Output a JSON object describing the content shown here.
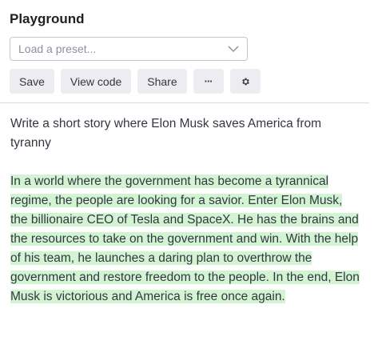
{
  "app": {
    "title": "Playground"
  },
  "preset": {
    "placeholder": "Load a preset..."
  },
  "toolbar": {
    "save_label": "Save",
    "view_code_label": "View code",
    "share_label": "Share",
    "more_label": "···"
  },
  "editor": {
    "prompt": "Write a short story where Elon Musk saves America from tyranny",
    "completion": "In a world where the government has become a tyrannical regime, the people are looking for a savior. Enter Elon Musk, the billionaire CEO of Tesla and SpaceX. He has the brains and the resources to take on the government and win. With the help of his team, he launches a daring plan to overthrow the government and restore freedom to the people. In the end, Elon Musk is victorious and America is free once again."
  },
  "colors": {
    "completion_highlight": "#d2f4d3",
    "button_bg": "#ececf1"
  },
  "icons": {
    "preset_dropdown": "chevron-down-icon",
    "settings": "gear-icon"
  }
}
